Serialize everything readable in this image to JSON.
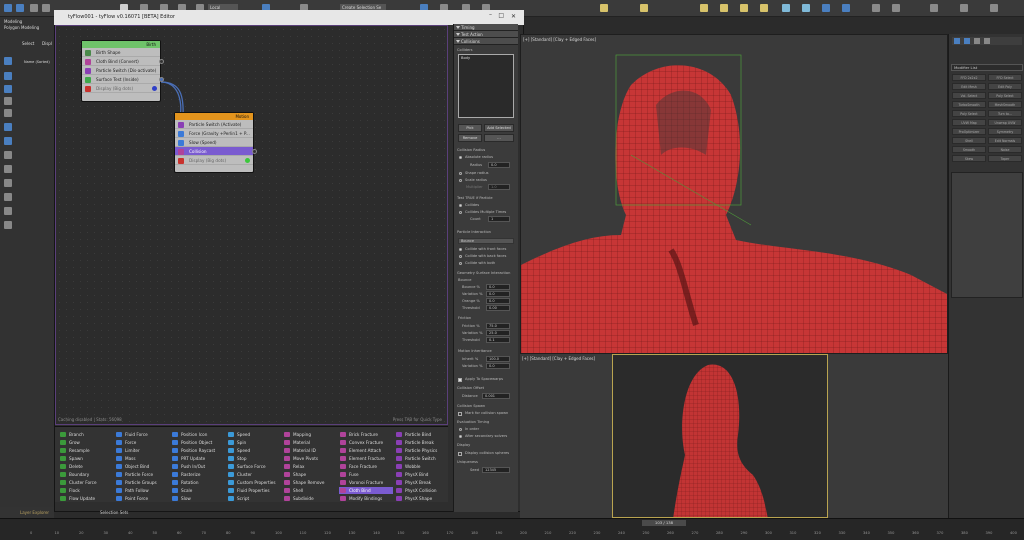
{
  "ribbon": {
    "tab_modeling": "Modeling",
    "tab_polygon": "Polygon Modeling",
    "select": "Select",
    "display": "Displ",
    "name_col": "Name (Sorted)"
  },
  "toolbar": {
    "view_dropdown": "Local",
    "selection_set": "Create Selection Se"
  },
  "flow": {
    "title": "tyFlow001 - tyFlow v0.16071 [BETA] Editor",
    "status_left": "Caching disabled | Stats: 56098",
    "status_right": "Press TAB for Quick Type"
  },
  "birth_node": {
    "header": "Birth",
    "header_color": "#6fc36a",
    "rows": [
      "Birth Shape",
      "Cloth Bind (Convert)",
      "Particle Switch (Dis-activate)",
      "Surface Test (Inside)",
      "Display (Big dots)"
    ],
    "icons": [
      "#4a8a4a",
      "#b0439a",
      "#8a3fb5",
      "#3fa84a",
      "#c8322d"
    ]
  },
  "motion_node": {
    "header": "Motion",
    "header_color": "#e3941d",
    "rows": [
      "Particle Switch (Activate)",
      "Force (Gravity +Perlin1 + P...",
      "Slow (Speed)",
      "Collision",
      "Display (Big dots)"
    ],
    "icons": [
      "#8a3fb5",
      "#3b7ad8",
      "#3b7ad8",
      "#b0439a",
      "#c8322d"
    ]
  },
  "rpanel": {
    "sec_timing": "Timing",
    "sec_test": "Test Action",
    "sec_collision": "Collisions",
    "colliders": "Colliders",
    "collider_item": "Body",
    "pick": "Pick",
    "add_selected": "Add Selected",
    "remove": "Remove",
    "ellipsis": "...",
    "collision_radius": "Collision Radius",
    "absolute_radius": "Absolute radius",
    "radius": "Radius",
    "radius_val": "0.0",
    "shape_radius": "Shape radius",
    "scale_radius": "Scale radius",
    "multiplier": "Multiplier",
    "multiplier_val": "1.0",
    "test_true": "Test TRUE if Particle",
    "collides": "Collides",
    "collides_multiple": "Collides Multiple Times",
    "count": "Count",
    "count_val": "1",
    "particle_interaction": "Particle Interaction",
    "bounce_select": "Bounce",
    "collide_front": "Collide with front faces",
    "collide_back": "Collide with back faces",
    "collide_both": "Collide with both",
    "geom_interaction": "Geometry Surface Interaction",
    "bounce_label": "Bounce",
    "bounce_pct": "Bounce %",
    "bounce_pct_val": "0.0",
    "variation1": "Variation %",
    "variation1_val": "0.0",
    "orange": "Orange %",
    "orange_val": "0.0",
    "threshold1": "Threshold",
    "threshold1_val": "0.00",
    "friction_label": "Friction",
    "friction_pct": "Friction %",
    "friction_val": "75.0",
    "variation2": "Variation %",
    "variation2_val": "25.0",
    "threshold2": "Threshold",
    "threshold2_val": "0.1",
    "motion_inherit": "Motion Inheritance",
    "inherit_pct": "Inherit %",
    "inherit_val": "100.0",
    "variation3": "Variation %",
    "variation3_val": "0.0",
    "apply_spacewarps": "Apply To Spacewarps",
    "collision_offset": "Collision Offset",
    "distance": "Distance",
    "distance_val": "0.001",
    "collision_spawn": "Collision Spawn",
    "mark_spawn": "Mark for collision spawn",
    "eval_timing": "Evaluation Timing",
    "in_order": "In order",
    "after_secondary": "After secondary solvers",
    "display": "Display",
    "display_spheres": "Display collision spheres",
    "uniqueness": "Uniqueness",
    "seed": "Seed",
    "seed_val": "12345"
  },
  "operators": [
    [
      "Branch",
      "Grow",
      "Resample",
      "Spawn",
      "Delete",
      "Boundary",
      "Cluster Force",
      "Flock",
      "Flow Update"
    ],
    [
      "Fluid Force",
      "Force",
      "Limiter",
      "Mass",
      "Object Bind",
      "Particle Force",
      "Particle Groups",
      "Path Follow",
      "Point Force"
    ],
    [
      "Position Icon",
      "Position Object",
      "Position Raycast",
      "PRT Update",
      "Push In/Out",
      "Rasterize",
      "Rotation",
      "Scale",
      "Slow"
    ],
    [
      "Speed",
      "Spin",
      "Speed",
      "Stop",
      "Surface Force",
      "Cluster",
      "Custom Properties",
      "Fluid Properties",
      "Script"
    ],
    [
      "Mapping",
      "Material",
      "Material ID",
      "Move Pivots",
      "Relax",
      "Shape",
      "Shape Remove",
      "Shell",
      "Subdivide"
    ],
    [
      "Brick Fracture",
      "Convex Fracture",
      "Element Attach",
      "Element Fracture",
      "Face Fracture",
      "Fuse",
      "Voronoi Fracture",
      "Cloth Bind",
      "Modify Bindings"
    ],
    [
      "Particle Bind",
      "Particle Break",
      "Particle Physics",
      "Particle Switch",
      "Wobble",
      "PhysX Bind",
      "PhysX Break",
      "PhysX Collision",
      "PhysX Shape"
    ]
  ],
  "viewports": {
    "vp1_label": "[+] [Standard] [Clay + Edged Faces]",
    "vp2_label": "[+] [Standard] [Clay + Edged Faces]",
    "frame": "103 / 138"
  },
  "cmdpanel": {
    "modifier_list": "Modifier List",
    "mods": [
      "FFD 2x2x2",
      "FFD Select",
      "Edit Mesh",
      "Edit Poly",
      "Vol. Select",
      "Poly Select",
      "TurboSmooth",
      "MeshSmooth",
      "Poly Select",
      "Turn to...",
      "UVW Map",
      "Unwrap UVW",
      "ProOptimizer",
      "Symmetry",
      "Shell",
      "Edit Normals",
      "Smooth",
      "Noise",
      "Skew",
      "Taper"
    ]
  },
  "bottom": {
    "layer_explorer": "Layer Explorer",
    "selection_sets": "Selection Sets"
  },
  "timeline": {
    "ticks": [
      "0",
      "10",
      "20",
      "30",
      "40",
      "50",
      "60",
      "70",
      "80",
      "90",
      "100",
      "110",
      "120",
      "130",
      "140",
      "150",
      "160",
      "170",
      "180",
      "190",
      "200",
      "210",
      "220",
      "230",
      "240",
      "250",
      "260",
      "270",
      "280",
      "290",
      "300",
      "310",
      "320",
      "330",
      "340",
      "350",
      "360",
      "370",
      "380",
      "390",
      "400"
    ]
  }
}
